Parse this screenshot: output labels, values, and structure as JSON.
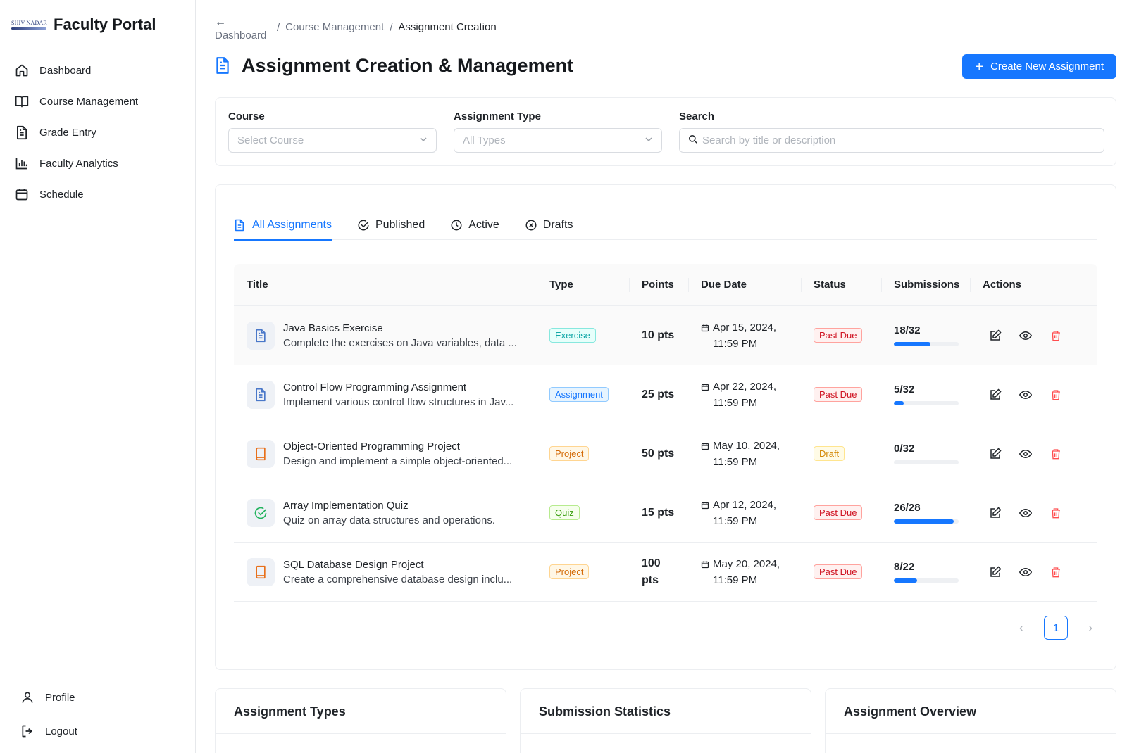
{
  "brand": {
    "logo_text": "SHIV NADAR",
    "title": "Faculty Portal"
  },
  "sidebar": {
    "items": [
      {
        "label": "Dashboard",
        "icon": "home-icon"
      },
      {
        "label": "Course Management",
        "icon": "book-icon"
      },
      {
        "label": "Grade Entry",
        "icon": "document-icon"
      },
      {
        "label": "Faculty Analytics",
        "icon": "bar-chart-icon"
      },
      {
        "label": "Schedule",
        "icon": "calendar-icon"
      }
    ],
    "bottom": [
      {
        "label": "Profile",
        "icon": "user-icon"
      },
      {
        "label": "Logout",
        "icon": "logout-icon"
      }
    ]
  },
  "breadcrumb": {
    "back": "Dashboard",
    "items": [
      "Course Management",
      "Assignment Creation"
    ]
  },
  "page": {
    "title": "Assignment Creation & Management",
    "create_button": "Create New Assignment"
  },
  "filters": {
    "course": {
      "label": "Course",
      "placeholder": "Select Course"
    },
    "type": {
      "label": "Assignment Type",
      "placeholder": "All Types"
    },
    "search": {
      "label": "Search",
      "placeholder": "Search by title or description"
    }
  },
  "tabs": [
    {
      "label": "All Assignments",
      "icon": "document-icon",
      "active": true
    },
    {
      "label": "Published",
      "icon": "check-circle-icon",
      "active": false
    },
    {
      "label": "Active",
      "icon": "clock-icon",
      "active": false
    },
    {
      "label": "Drafts",
      "icon": "x-circle-icon",
      "active": false
    }
  ],
  "table": {
    "columns": [
      "Title",
      "Type",
      "Points",
      "Due Date",
      "Status",
      "Submissions",
      "Actions"
    ],
    "rows": [
      {
        "title": "Java Basics Exercise",
        "desc": "Complete the exercises on Java variables, data ...",
        "icon": "document-icon",
        "type": "Exercise",
        "points": "10 pts",
        "due_date": "Apr 15, 2024,",
        "due_time": "11:59 PM",
        "status": "Past Due",
        "submissions": "18/32",
        "progress": 0.5625
      },
      {
        "title": "Control Flow Programming Assignment",
        "desc": "Implement various control flow structures in Jav...",
        "icon": "document-icon",
        "type": "Assignment",
        "points": "25 pts",
        "due_date": "Apr 22, 2024,",
        "due_time": "11:59 PM",
        "status": "Past Due",
        "submissions": "5/32",
        "progress": 0.156
      },
      {
        "title": "Object-Oriented Programming Project",
        "desc": "Design and implement a simple object-oriented...",
        "icon": "book-icon",
        "type": "Project",
        "points": "50 pts",
        "due_date": "May 10, 2024,",
        "due_time": "11:59 PM",
        "status": "Draft",
        "submissions": "0/32",
        "progress": 0
      },
      {
        "title": "Array Implementation Quiz",
        "desc": "Quiz on array data structures and operations.",
        "icon": "check-circle-icon",
        "type": "Quiz",
        "points": "15 pts",
        "due_date": "Apr 12, 2024,",
        "due_time": "11:59 PM",
        "status": "Past Due",
        "submissions": "26/28",
        "progress": 0.9286
      },
      {
        "title": "SQL Database Design Project",
        "desc": "Create a comprehensive database design inclu...",
        "icon": "book-icon",
        "type": "Project",
        "points_line1": "100",
        "points_line2": "pts",
        "due_date": "May 20, 2024,",
        "due_time": "11:59 PM",
        "status": "Past Due",
        "submissions": "8/22",
        "progress": 0.3636
      }
    ]
  },
  "pagination": {
    "current": "1"
  },
  "panels": [
    "Assignment Types",
    "Submission Statistics",
    "Assignment Overview"
  ],
  "colors": {
    "accent": "#1677ff",
    "danger": "#ff4d4f",
    "exercise": "#13a8a8",
    "assignment": "#1677ff",
    "project": "#d46b08",
    "quiz": "#389e0d",
    "draft": "#d48806"
  }
}
